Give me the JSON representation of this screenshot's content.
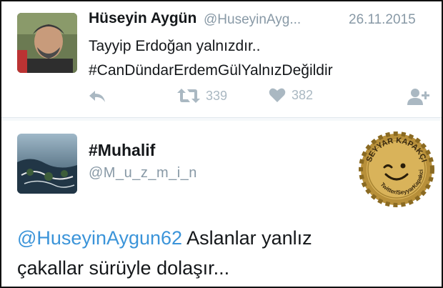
{
  "tweet1": {
    "name": "Hüseyin Aygün",
    "handle": "@HuseyinAyg...",
    "date": "26.11.2015",
    "line1": "Tayyip Erdoğan yalnızdır..",
    "line2": "#CanDündarErdemGülYalnızDeğildir",
    "actions": {
      "reply_icon": "reply-icon",
      "retweet_icon": "retweet-icon",
      "retweet_count": "339",
      "like_icon": "heart-icon",
      "like_count": "382",
      "follow_icon": "follow-icon"
    }
  },
  "tweet2": {
    "name": "#Muhalif",
    "handle": "@M_u_z_m_i_n",
    "mention": "@HuseyinAygun62",
    "text_after_mention": " Aslanlar yanlız",
    "line2": "çakallar sürüyle dolaşır..."
  },
  "watermark": {
    "top_text": "SEYYAR KAPAKÇI",
    "bottom_text": "Twitter/SeyyarKapakci"
  },
  "colors": {
    "link": "#3b94d9",
    "meta": "#8899a6",
    "action": "#aab8c2",
    "bottle_cap": "#c9a54a"
  }
}
